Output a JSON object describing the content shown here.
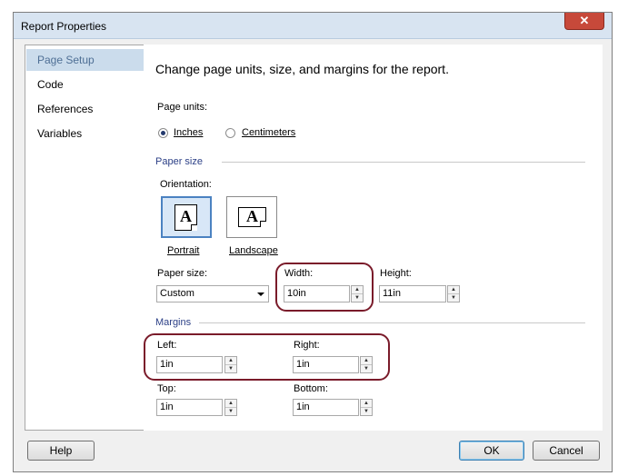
{
  "window": {
    "title": "Report Properties",
    "close_glyph": "✕"
  },
  "nav": {
    "items": [
      {
        "label": "Page Setup",
        "selected": true
      },
      {
        "label": "Code"
      },
      {
        "label": "References"
      },
      {
        "label": "Variables"
      }
    ]
  },
  "content": {
    "description": "Change page units, size, and margins for the report.",
    "page_units": {
      "label": "Page units:",
      "options": [
        {
          "label": "Inches",
          "selected": true
        },
        {
          "label": "Centimeters"
        }
      ]
    },
    "paper_size_section": "Paper size",
    "orientation": {
      "label": "Orientation:",
      "portrait_label": "Portrait",
      "landscape_label": "Landscape",
      "selected": "Portrait",
      "icon_letter": "A"
    },
    "paper_size": {
      "label": "Paper size:",
      "value": "Custom"
    },
    "width": {
      "label": "Width:",
      "value": "10in"
    },
    "height": {
      "label": "Height:",
      "value": "11in"
    },
    "margins_section": "Margins",
    "left": {
      "label": "Left:",
      "value": "1in"
    },
    "right": {
      "label": "Right:",
      "value": "1in"
    },
    "top": {
      "label": "Top:",
      "value": "1in"
    },
    "bottom": {
      "label": "Bottom:",
      "value": "1in"
    }
  },
  "buttons": {
    "help": "Help",
    "ok": "OK",
    "cancel": "Cancel"
  },
  "colors": {
    "highlight": "#7a1b2a",
    "selection": "#cbdcec",
    "section_text": "#2b3f86"
  }
}
